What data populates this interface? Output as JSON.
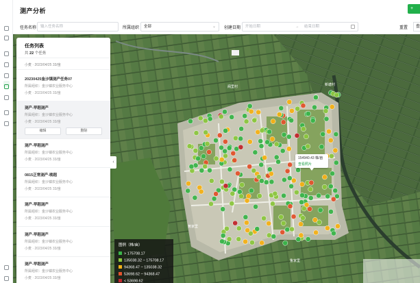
{
  "header": {
    "title": "测产分析",
    "new_button": "+"
  },
  "filters": {
    "task_name_label": "任务名称",
    "task_name_placeholder": "输入任务名称",
    "org_label": "所属组织",
    "org_value": "全部",
    "date_label": "创建日期",
    "start_placeholder": "开始日期",
    "range_sep": "→",
    "end_placeholder": "结束日期",
    "reset": "重置",
    "query": "查"
  },
  "sidebar_icons": [
    "map-pin-icon",
    "grid-icon",
    "bank-icon",
    "list-icon",
    "scissors-icon",
    "analytics-icon",
    "chart-icon",
    "layout-icon",
    "network-icon",
    "settings-icon",
    "user-icon"
  ],
  "panel": {
    "title": "任务列表",
    "count_prefix": "共",
    "count": "22",
    "count_suffix": "个任务",
    "top_line": "小麦 · 2023/04/25 33/亩",
    "tasks": [
      {
        "title": "20230425金沙镇测产任务07",
        "lines": [
          "所属组织：金沙镇农业服务中心",
          "小麦 · 2023/04/25 33/亩"
        ]
      },
      {
        "title": "测产-早稻测产",
        "lines": [
          "所属组织：金沙镇农业服务中心",
          "小麦 · 2023/04/25 33/亩"
        ],
        "buttons": [
          "编辑",
          "删除"
        ]
      },
      {
        "title": "测产-早稻测产",
        "lines": [
          "所属组织：金沙镇农业服务中心",
          "小麦 · 2023/04/25 33/亩"
        ]
      },
      {
        "title": "0815正常测产-晚稻",
        "lines": [
          "所属组织：金沙镇农业服务中心",
          "小麦 · 2023/04/25 33/亩"
        ]
      },
      {
        "title": "测产-早稻测产",
        "lines": [
          "所属组织：金沙镇农业服务中心",
          "小麦 · 2023/04/25 33/亩"
        ]
      },
      {
        "title": "测产-早稻测产",
        "lines": [
          "所属组织：金沙镇农业服务中心",
          "小麦 · 2023/04/25 33/亩"
        ]
      },
      {
        "title": "测产-早稻测产",
        "lines": [
          "所属组织：金沙镇农业服务中心",
          "小麦 · 2023/04/25 33/亩"
        ]
      }
    ]
  },
  "tooltip": {
    "value": "154940.43 株/亩",
    "link": "查看照片"
  },
  "legend": {
    "title": "图例（株/亩）",
    "items": [
      {
        "label": "> 175708.17",
        "color": "#3bb54a"
      },
      {
        "label": "135038.32 ~ 175708.17",
        "color": "#8cc63f"
      },
      {
        "label": "94368.47 ~ 135038.32",
        "color": "#f5b117"
      },
      {
        "label": "53698.62 ~ 94368.47",
        "color": "#e2532d"
      },
      {
        "label": "< 53698.62",
        "color": "#c1272d"
      }
    ]
  },
  "map_labels": [
    "阁里村",
    "新塘村",
    "黄家里",
    "鲁家里"
  ]
}
